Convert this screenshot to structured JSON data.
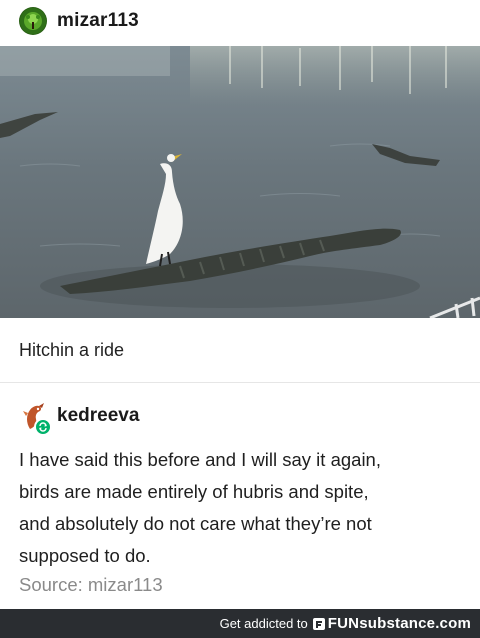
{
  "original_post": {
    "username": "mizar113",
    "avatar_icon": "green-tree-avatar-icon",
    "caption": "Hitchin a ride"
  },
  "reblog": {
    "username": "kedreeva",
    "avatar_icon": "dragon-avatar-icon",
    "badge_icon": "reblog-icon",
    "badge_color": "#00b26b",
    "text_lines": [
      "I have said this before and I will say it again,",
      "birds are made entirely of hubris and spite,",
      "and absolutely do not care what they’re not",
      "supposed to do."
    ],
    "source": "Source: mizar113"
  },
  "banner": {
    "text": "Get addicted to",
    "logo": "FUNsubstance.com",
    "background": "#2a2d31"
  }
}
